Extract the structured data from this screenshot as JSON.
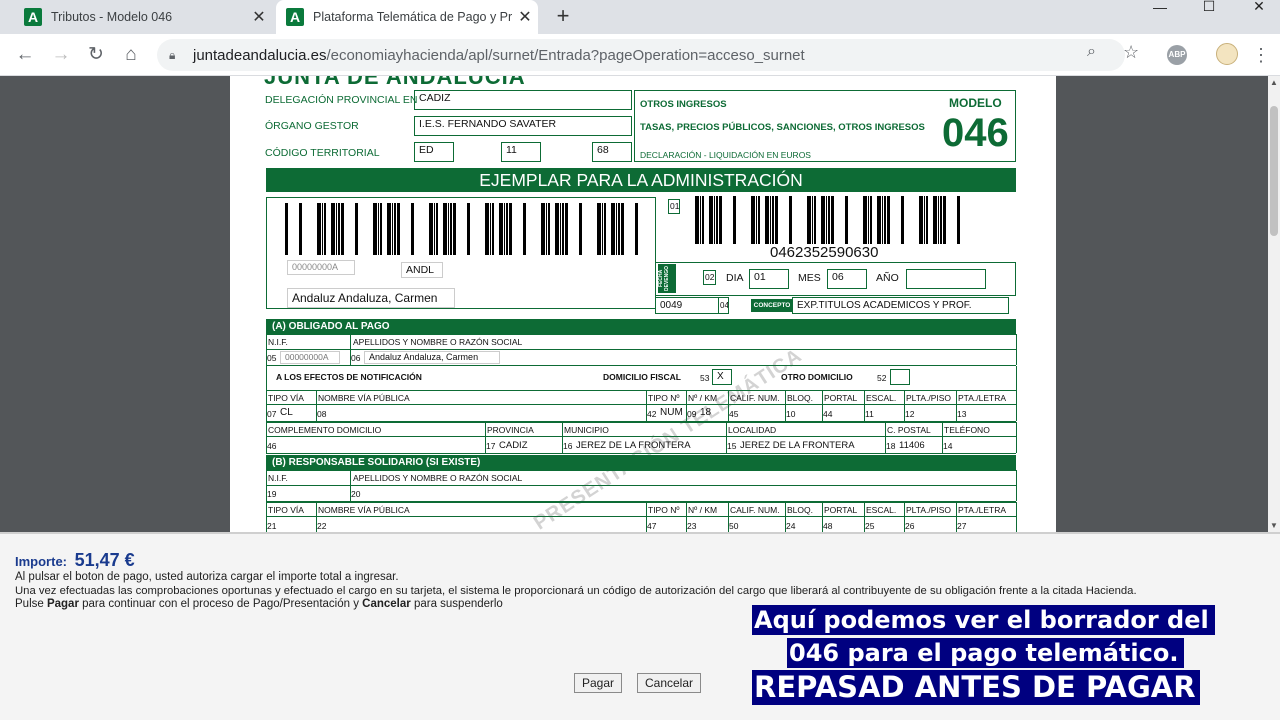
{
  "browser": {
    "tabs": [
      {
        "title": "Tributos - Modelo 046",
        "icon": "junta-andalucia-icon"
      },
      {
        "title": "Plataforma Telemática de Pago y Pre",
        "icon": "junta-andalucia-icon"
      }
    ],
    "url_host": "juntadeandalucia.es",
    "url_path": "/economiayhacienda/apl/surnet/Entrada?pageOperation=acceso_surnet",
    "ext_abp": "ABP",
    "colors": {
      "accent_green": "#0d6b35",
      "caption_bg": "#000080",
      "importe_blue": "#1a3b8e"
    }
  },
  "form": {
    "header_partial": "JUNTA DE ANDALUCIA",
    "delegacion_label": "DELEGACIÓN PROVINCIAL EN",
    "delegacion_value": "CADIZ",
    "organo_label": "ÓRGANO GESTOR",
    "organo_value": "I.E.S. FERNANDO SAVATER",
    "codigo_label": "CÓDIGO TERRITORIAL",
    "codigo_1": "ED",
    "codigo_2": "11",
    "codigo_3": "68",
    "otros_ingresos": "OTROS INGRESOS",
    "tasas": "TASAS, PRECIOS PÚBLICOS, SANCIONES, OTROS INGRESOS",
    "declaracion": "DECLARACIÓN - LIQUIDACIÓN EN EUROS",
    "modelo_label": "MODELO",
    "modelo_num": "046",
    "ejemplar": "EJEMPLAR PARA LA ADMINISTRACIÓN",
    "barcode_num": "0462352590630",
    "nif_small": "00000000A",
    "andl": "ANDL",
    "nombre_box": "Andaluz Andaluza, Carmen",
    "f01": "01",
    "f02": "02",
    "dia_label": "DIA",
    "dia_value": "01",
    "mes_label": "MES",
    "mes_value": "06",
    "anio_label": "AÑO",
    "anio_value": "",
    "fecha_label": "FECHA DEVENGO",
    "f04_value": "0049",
    "f04": "04",
    "concepto_label": "CONCEPTO",
    "concepto_value": "EXP.TITULOS ACADEMICOS Y PROF.",
    "sec_a": "(A) OBLIGADO AL PAGO",
    "nif_h": "N.I.F.",
    "apellidos_h": "APELLIDOS Y NOMBRE O RAZÓN SOCIAL",
    "f05": "05",
    "nif_value": "00000000A",
    "f06": "06",
    "nombre_value": "Andaluz Andaluza, Carmen",
    "notif": "A LOS EFECTOS DE NOTIFICACIÓN",
    "domfiscal": "DOMICILIO FISCAL",
    "f53": "53",
    "f53_value": "X",
    "otrodom": "OTRO DOMICILIO",
    "f52": "52",
    "headers_via": [
      "TIPO VÍA",
      "NOMBRE VÍA PÚBLICA",
      "TIPO Nº",
      "Nº / KM",
      "CALIF. NUM.",
      "BLOQ.",
      "PORTAL",
      "ESCAL.",
      "PLTA./PISO",
      "PTA./LETRA"
    ],
    "via_nums_a": [
      "07",
      "08",
      "42",
      "09",
      "45",
      "10",
      "44",
      "11",
      "12",
      "13"
    ],
    "via_vals_a": [
      "CL",
      "",
      "NUM",
      "18",
      "",
      "",
      "",
      "",
      "",
      ""
    ],
    "headers_dom": [
      "COMPLEMENTO DOMICILIO",
      "PROVINCIA",
      "MUNICIPIO",
      "LOCALIDAD",
      "C. POSTAL",
      "TELÉFONO"
    ],
    "dom_nums": [
      "46",
      "17",
      "16",
      "15",
      "18",
      "14"
    ],
    "dom_vals": [
      "",
      "CADIZ",
      "JEREZ DE LA FRONTERA",
      "JEREZ DE LA FRONTERA",
      "11406",
      ""
    ],
    "sec_b": "(B) RESPONSABLE SOLIDARIO (SI EXISTE)",
    "f19": "19",
    "f20": "20",
    "via_nums_b": [
      "21",
      "22",
      "47",
      "23",
      "50",
      "24",
      "48",
      "25",
      "26",
      "27"
    ],
    "watermark": "PRESENTACIÓN TELEMÁTICA"
  },
  "payment": {
    "importe_label": "Importe:",
    "importe_value": "51,47 €",
    "line1": "Al pulsar el boton de pago, usted autoriza cargar el importe total a ingresar.",
    "line2": "Una vez efectuadas las comprobaciones oportunas y efectuado el cargo en su tarjeta, el sistema le proporcionará un código de autorización del cargo que liberará al contribuyente de su obligación frente a la citada Hacienda.",
    "line3_a": "Pulse ",
    "line3_pagar": "Pagar",
    "line3_b": " para continuar con el proceso de Pago/Presentación y ",
    "line3_cancelar": "Cancelar",
    "line3_c": " para suspenderlo",
    "pagar_button": "Pagar",
    "cancelar_button": "Cancelar"
  },
  "captions": {
    "line1": "Aquí podemos ver el borrador del",
    "line2": "046 para el pago telemático.",
    "line3": "REPASAD ANTES DE PAGAR"
  }
}
